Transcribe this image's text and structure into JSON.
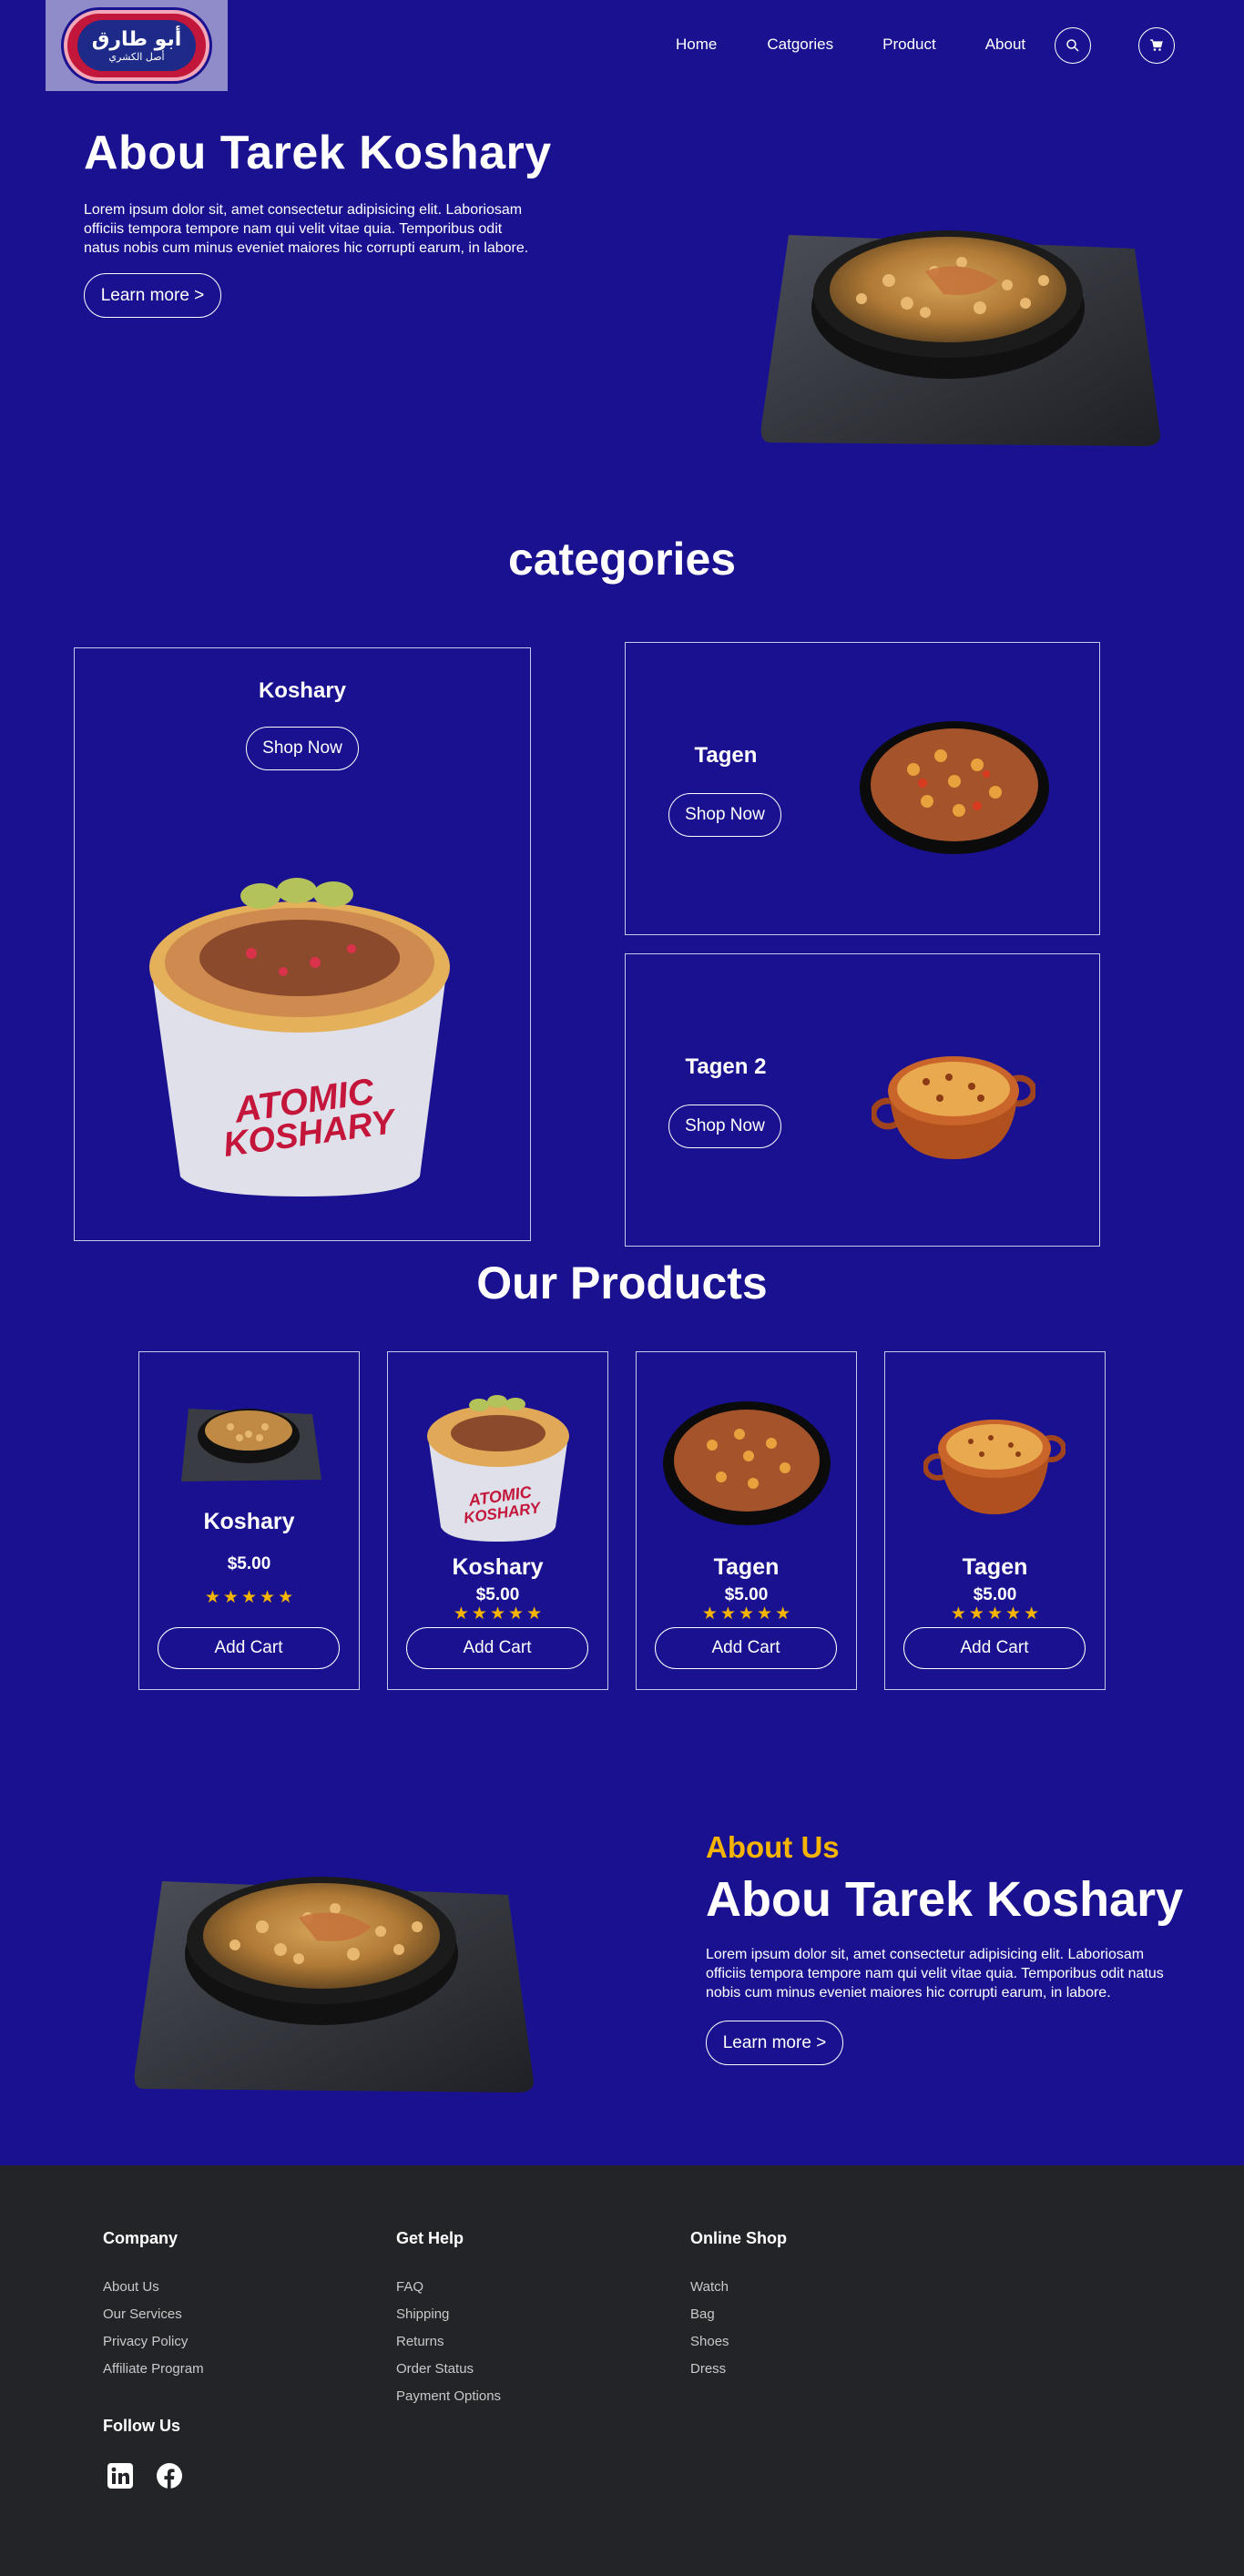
{
  "header": {
    "logo_main": "أبو طارق",
    "logo_sub": "أصل الكشري",
    "nav": [
      "Home",
      "Catgories",
      "Product",
      "About"
    ],
    "icons": {
      "search": "search-icon",
      "cart": "cart-icon"
    }
  },
  "hero": {
    "title": "Abou Tarek Koshary",
    "text": "Lorem ipsum dolor sit, amet consectetur adipisicing elit. Laboriosam officiis tempora tempore nam qui velit vitae quia. Temporibus odit natus nobis cum minus eveniet maiores hic corrupti earum, in labore.",
    "button": "Learn more >"
  },
  "categories": {
    "title": "categories",
    "items": [
      {
        "name": "Koshary",
        "button": "Shop Now"
      },
      {
        "name": "Tagen",
        "button": "Shop Now"
      },
      {
        "name": "Tagen 2",
        "button": "Shop Now"
      }
    ]
  },
  "products": {
    "title": "Our Products",
    "items": [
      {
        "name": "Koshary",
        "price": "$5.00",
        "rating": 5,
        "button": "Add Cart"
      },
      {
        "name": "Koshary",
        "price": "$5.00",
        "rating": 5,
        "button": "Add Cart"
      },
      {
        "name": "Tagen",
        "price": "$5.00",
        "rating": 5,
        "button": "Add Cart"
      },
      {
        "name": "Tagen",
        "price": "$5.00",
        "rating": 5,
        "button": "Add Cart"
      }
    ]
  },
  "about": {
    "label": "About Us",
    "title": "Abou Tarek Koshary",
    "text": "Lorem ipsum dolor sit, amet consectetur adipisicing elit. Laboriosam officiis tempora tempore nam qui velit vitae quia. Temporibus odit natus nobis cum minus eveniet maiores hic corrupti earum, in labore.",
    "button": "Learn more >"
  },
  "footer": {
    "company": {
      "title": "Company",
      "links": [
        "About Us",
        "Our Services",
        "Privacy Policy",
        "Affiliate Program"
      ]
    },
    "help": {
      "title": "Get Help",
      "links": [
        "FAQ",
        "Shipping",
        "Returns",
        "Order Status",
        "Payment Options"
      ]
    },
    "shop": {
      "title": "Online Shop",
      "links": [
        "Watch",
        "Bag",
        "Shoes",
        "Dress"
      ]
    },
    "follow": {
      "title": "Follow Us",
      "icons": [
        "linkedin-icon",
        "facebook-icon"
      ]
    }
  },
  "colors": {
    "background": "#1a1190",
    "footer": "#232427",
    "accent": "#f4b400",
    "border": "#c8c8e8"
  }
}
